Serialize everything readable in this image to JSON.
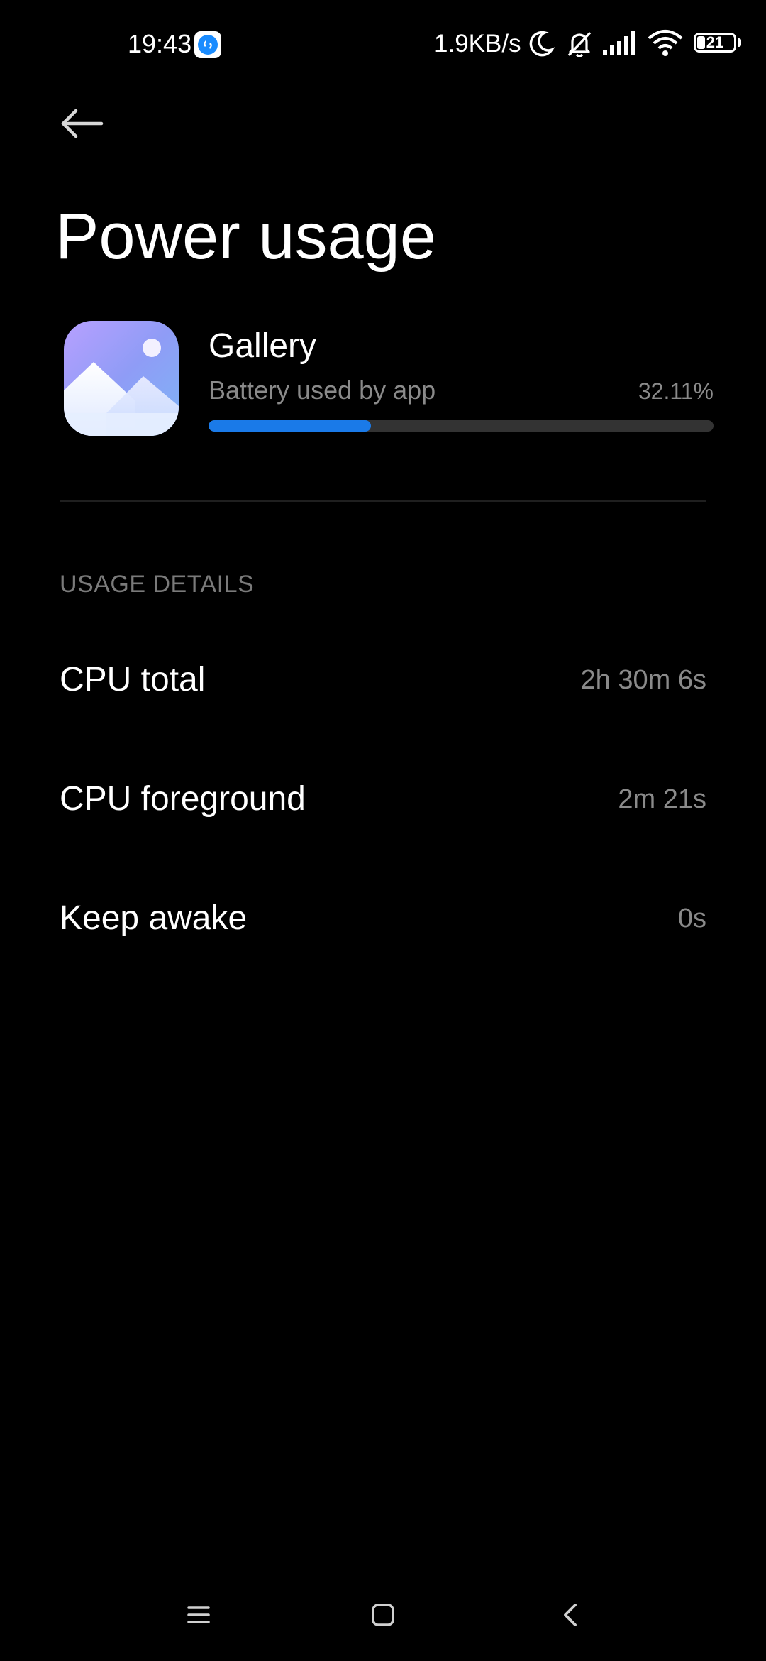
{
  "status_bar": {
    "time": "19:43",
    "network_speed": "1.9KB/s",
    "battery_level": "21",
    "battery_fraction": 0.21,
    "icons": [
      "shazam-icon",
      "moon-icon",
      "bell-off-icon",
      "signal-icon",
      "wifi-icon",
      "battery-icon"
    ]
  },
  "header": {
    "title": "Power usage",
    "back_icon": "arrow-left-icon"
  },
  "app": {
    "name": "Gallery",
    "usage_label": "Battery used by app",
    "usage_percent": "32.11%",
    "usage_fraction": 0.3211,
    "icon": "gallery-icon"
  },
  "colors": {
    "accent": "#1a7ae8",
    "background": "#000000",
    "secondary_text": "#8a8a8a"
  },
  "usage_details": {
    "header": "USAGE DETAILS",
    "rows": [
      {
        "label": "CPU total",
        "value": "2h 30m 6s"
      },
      {
        "label": "CPU foreground",
        "value": "2m 21s"
      },
      {
        "label": "Keep awake",
        "value": "0s"
      }
    ]
  },
  "nav_bar": {
    "icons": [
      "menu-icon",
      "home-icon",
      "back-icon"
    ]
  }
}
